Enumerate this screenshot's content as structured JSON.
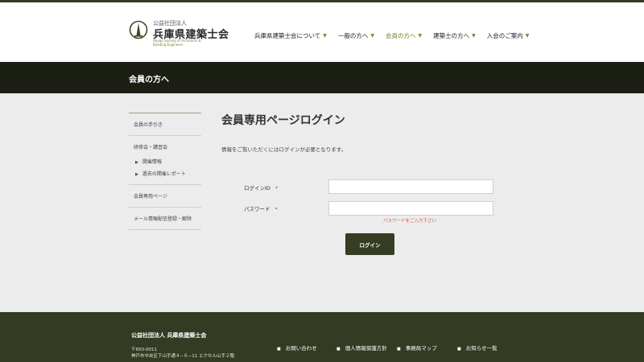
{
  "header": {
    "logo": {
      "small_text": "公益社団法人",
      "name": "兵庫県建築士会",
      "en_line1": "Hyogo Society of Architects &",
      "en_line2": "Building Engineers"
    },
    "nav": [
      {
        "label": "兵庫県建築士会について"
      },
      {
        "label": "一般の方へ"
      },
      {
        "label": "会員の方へ"
      },
      {
        "label": "建築士の方へ"
      },
      {
        "label": "入会のご案内"
      }
    ]
  },
  "page_bar": {
    "title": "会員の方へ"
  },
  "sidebar": {
    "items": [
      {
        "label": "会員の手引き"
      },
      {
        "label": "研修会・講習会"
      },
      {
        "label": "開催情報"
      },
      {
        "label": "過去の開催レポート"
      },
      {
        "label": "会員専用ページ"
      },
      {
        "label": "メール情報配信登録・解除"
      }
    ]
  },
  "main": {
    "title": "会員専用ページログイン",
    "description": "情報をご覧いただくにはログインが必要となります。",
    "form": {
      "login_id_label": "ログインID",
      "password_label": "パスワード",
      "required_mark": "*",
      "login_id_value": "",
      "password_value": "",
      "error": "パスワードをご入力下さい",
      "submit_label": "ログイン"
    }
  },
  "footer": {
    "org": "公益社団法人 兵庫県建築士会",
    "zip": "〒650-0011",
    "address": "神戸市中央区下山手通４−６−11 エクセル山手２階",
    "links": [
      {
        "label": "お問い合わせ"
      },
      {
        "label": "個人情報保護方針"
      },
      {
        "label": "事務局マップ"
      },
      {
        "label": "お知らせ一覧"
      }
    ]
  },
  "colors": {
    "accent": "#6b8a2a",
    "dark_green": "#333b22",
    "page_bar": "#1c1f14",
    "error": "#d9534f"
  }
}
